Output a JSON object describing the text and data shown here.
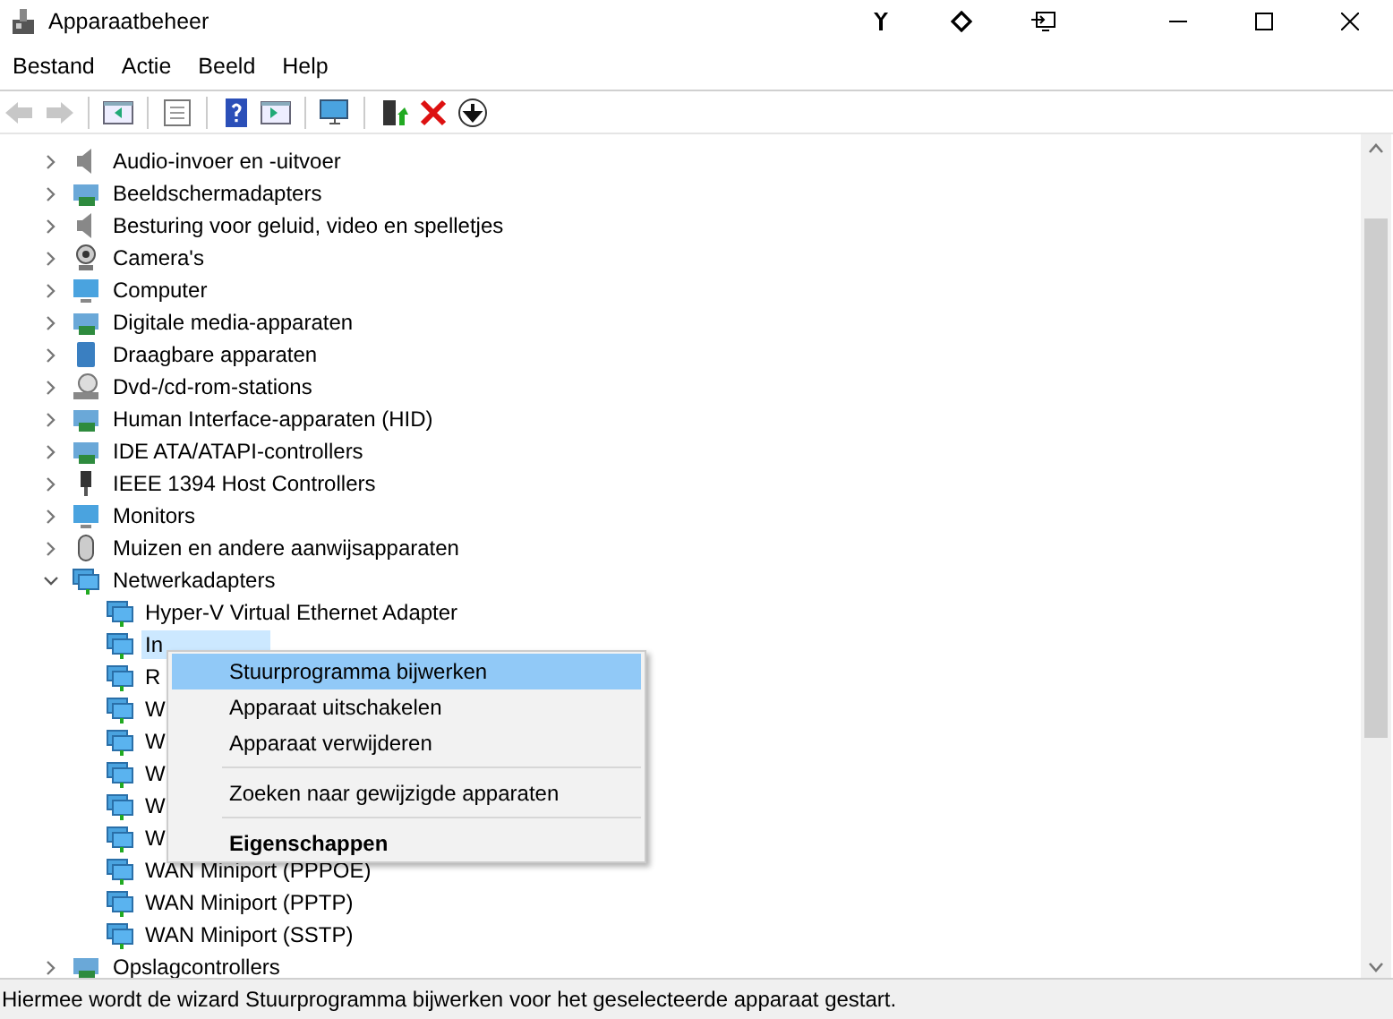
{
  "window": {
    "title": "Apparaatbeheer"
  },
  "menu": [
    "Bestand",
    "Actie",
    "Beeld",
    "Help"
  ],
  "toolbar": [
    {
      "kind": "back",
      "disabled": true
    },
    {
      "kind": "forward",
      "disabled": true
    },
    {
      "kind": "tree",
      "disabled": false
    },
    {
      "kind": "sheet",
      "disabled": false
    },
    {
      "kind": "help",
      "disabled": false
    },
    {
      "kind": "panel",
      "disabled": false
    },
    {
      "kind": "scan",
      "disabled": false
    },
    {
      "kind": "update",
      "disabled": false
    },
    {
      "kind": "remove",
      "disabled": false
    },
    {
      "kind": "down",
      "disabled": false
    }
  ],
  "tree": [
    {
      "label": "Audio-invoer en -uitvoer",
      "kind": "speaker",
      "expanded": false
    },
    {
      "label": "Beeldschermadapters",
      "kind": "card",
      "expanded": false
    },
    {
      "label": "Besturing voor geluid, video en spelletjes",
      "kind": "speaker",
      "expanded": false
    },
    {
      "label": "Camera's",
      "kind": "camera",
      "expanded": false
    },
    {
      "label": "Computer",
      "kind": "monitor",
      "expanded": false
    },
    {
      "label": "Digitale media-apparaten",
      "kind": "card",
      "expanded": false
    },
    {
      "label": "Draagbare apparaten",
      "kind": "tablet",
      "expanded": false
    },
    {
      "label": "Dvd-/cd-rom-stations",
      "kind": "disc",
      "expanded": false
    },
    {
      "label": "Human Interface-apparaten (HID)",
      "kind": "card",
      "expanded": false
    },
    {
      "label": "IDE ATA/ATAPI-controllers",
      "kind": "card",
      "expanded": false
    },
    {
      "label": "IEEE 1394 Host Controllers",
      "kind": "plug",
      "expanded": false
    },
    {
      "label": "Monitors",
      "kind": "monitor",
      "expanded": false
    },
    {
      "label": "Muizen en andere aanwijsapparaten",
      "kind": "mouse",
      "expanded": false
    },
    {
      "label": "Netwerkadapters",
      "kind": "network",
      "expanded": true,
      "children": [
        {
          "label": "Hyper-V Virtual Ethernet Adapter",
          "selected": false
        },
        {
          "label": "In",
          "selected": true
        },
        {
          "label": "R",
          "selected": false
        },
        {
          "label": "W",
          "selected": false
        },
        {
          "label": "W",
          "selected": false
        },
        {
          "label": "W",
          "selected": false
        },
        {
          "label": "W",
          "selected": false
        },
        {
          "label": "W",
          "selected": false
        },
        {
          "label": "WAN Miniport (PPPOE)",
          "selected": false
        },
        {
          "label": "WAN Miniport (PPTP)",
          "selected": false
        },
        {
          "label": "WAN Miniport (SSTP)",
          "selected": false
        }
      ]
    },
    {
      "label": "Opslagcontrollers",
      "kind": "card",
      "expanded": false
    }
  ],
  "context_menu": [
    {
      "label": "Stuurprogramma bijwerken",
      "selected": true,
      "bold": false
    },
    {
      "label": "Apparaat uitschakelen",
      "selected": false,
      "bold": false
    },
    {
      "label": "Apparaat verwijderen",
      "selected": false,
      "bold": false,
      "separator_after": true
    },
    {
      "label": "Zoeken naar gewijzigde apparaten",
      "selected": false,
      "bold": false,
      "separator_after": true
    },
    {
      "label": "Eigenschappen",
      "selected": false,
      "bold": true
    }
  ],
  "status_bar": "Hiermee wordt de wizard Stuurprogramma bijwerken voor het geselecteerde apparaat gestart."
}
